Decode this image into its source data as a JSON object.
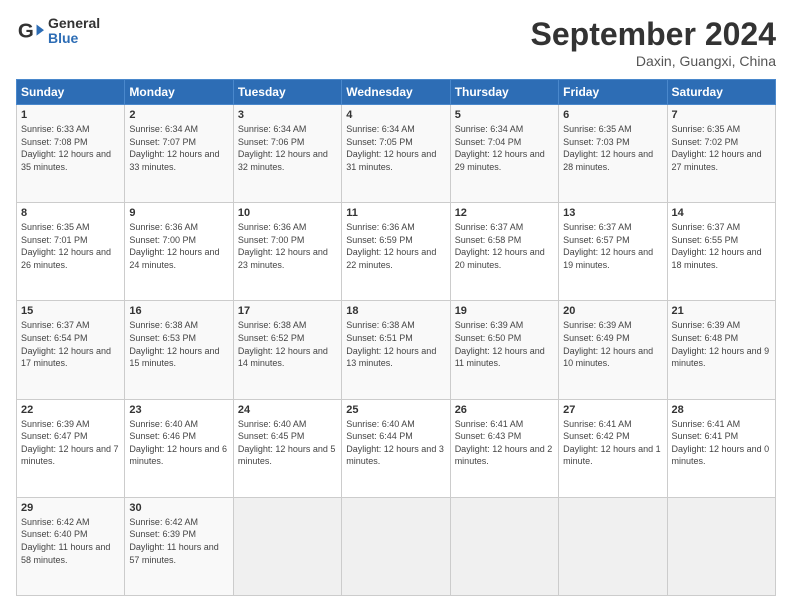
{
  "header": {
    "logo_line1": "General",
    "logo_line2": "Blue",
    "month": "September 2024",
    "location": "Daxin, Guangxi, China"
  },
  "days_of_week": [
    "Sunday",
    "Monday",
    "Tuesday",
    "Wednesday",
    "Thursday",
    "Friday",
    "Saturday"
  ],
  "weeks": [
    [
      {
        "day": "1",
        "rise": "6:33 AM",
        "set": "7:08 PM",
        "daylight": "12 hours and 35 minutes."
      },
      {
        "day": "2",
        "rise": "6:34 AM",
        "set": "7:07 PM",
        "daylight": "12 hours and 33 minutes."
      },
      {
        "day": "3",
        "rise": "6:34 AM",
        "set": "7:06 PM",
        "daylight": "12 hours and 32 minutes."
      },
      {
        "day": "4",
        "rise": "6:34 AM",
        "set": "7:05 PM",
        "daylight": "12 hours and 31 minutes."
      },
      {
        "day": "5",
        "rise": "6:34 AM",
        "set": "7:04 PM",
        "daylight": "12 hours and 29 minutes."
      },
      {
        "day": "6",
        "rise": "6:35 AM",
        "set": "7:03 PM",
        "daylight": "12 hours and 28 minutes."
      },
      {
        "day": "7",
        "rise": "6:35 AM",
        "set": "7:02 PM",
        "daylight": "12 hours and 27 minutes."
      }
    ],
    [
      {
        "day": "8",
        "rise": "6:35 AM",
        "set": "7:01 PM",
        "daylight": "12 hours and 26 minutes."
      },
      {
        "day": "9",
        "rise": "6:36 AM",
        "set": "7:00 PM",
        "daylight": "12 hours and 24 minutes."
      },
      {
        "day": "10",
        "rise": "6:36 AM",
        "set": "7:00 PM",
        "daylight": "12 hours and 23 minutes."
      },
      {
        "day": "11",
        "rise": "6:36 AM",
        "set": "6:59 PM",
        "daylight": "12 hours and 22 minutes."
      },
      {
        "day": "12",
        "rise": "6:37 AM",
        "set": "6:58 PM",
        "daylight": "12 hours and 20 minutes."
      },
      {
        "day": "13",
        "rise": "6:37 AM",
        "set": "6:57 PM",
        "daylight": "12 hours and 19 minutes."
      },
      {
        "day": "14",
        "rise": "6:37 AM",
        "set": "6:55 PM",
        "daylight": "12 hours and 18 minutes."
      }
    ],
    [
      {
        "day": "15",
        "rise": "6:37 AM",
        "set": "6:54 PM",
        "daylight": "12 hours and 17 minutes."
      },
      {
        "day": "16",
        "rise": "6:38 AM",
        "set": "6:53 PM",
        "daylight": "12 hours and 15 minutes."
      },
      {
        "day": "17",
        "rise": "6:38 AM",
        "set": "6:52 PM",
        "daylight": "12 hours and 14 minutes."
      },
      {
        "day": "18",
        "rise": "6:38 AM",
        "set": "6:51 PM",
        "daylight": "12 hours and 13 minutes."
      },
      {
        "day": "19",
        "rise": "6:39 AM",
        "set": "6:50 PM",
        "daylight": "12 hours and 11 minutes."
      },
      {
        "day": "20",
        "rise": "6:39 AM",
        "set": "6:49 PM",
        "daylight": "12 hours and 10 minutes."
      },
      {
        "day": "21",
        "rise": "6:39 AM",
        "set": "6:48 PM",
        "daylight": "12 hours and 9 minutes."
      }
    ],
    [
      {
        "day": "22",
        "rise": "6:39 AM",
        "set": "6:47 PM",
        "daylight": "12 hours and 7 minutes."
      },
      {
        "day": "23",
        "rise": "6:40 AM",
        "set": "6:46 PM",
        "daylight": "12 hours and 6 minutes."
      },
      {
        "day": "24",
        "rise": "6:40 AM",
        "set": "6:45 PM",
        "daylight": "12 hours and 5 minutes."
      },
      {
        "day": "25",
        "rise": "6:40 AM",
        "set": "6:44 PM",
        "daylight": "12 hours and 3 minutes."
      },
      {
        "day": "26",
        "rise": "6:41 AM",
        "set": "6:43 PM",
        "daylight": "12 hours and 2 minutes."
      },
      {
        "day": "27",
        "rise": "6:41 AM",
        "set": "6:42 PM",
        "daylight": "12 hours and 1 minute."
      },
      {
        "day": "28",
        "rise": "6:41 AM",
        "set": "6:41 PM",
        "daylight": "12 hours and 0 minutes."
      }
    ],
    [
      {
        "day": "29",
        "rise": "6:42 AM",
        "set": "6:40 PM",
        "daylight": "11 hours and 58 minutes."
      },
      {
        "day": "30",
        "rise": "6:42 AM",
        "set": "6:39 PM",
        "daylight": "11 hours and 57 minutes."
      },
      null,
      null,
      null,
      null,
      null
    ]
  ]
}
